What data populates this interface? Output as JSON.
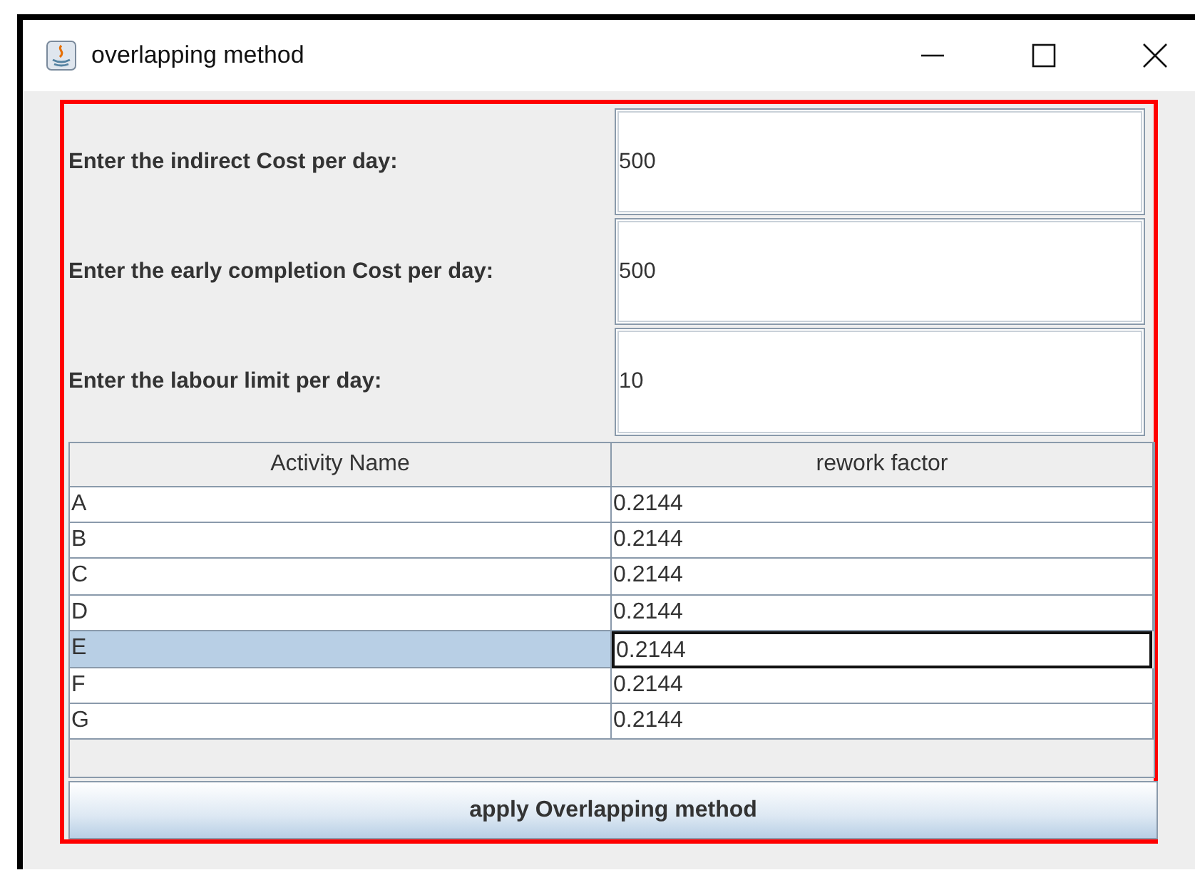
{
  "window": {
    "title": "overlapping method"
  },
  "fields": [
    {
      "label": "Enter the indirect Cost per day:",
      "value": "500"
    },
    {
      "label": "Enter the early completion Cost per day:",
      "value": "500"
    },
    {
      "label": "Enter the labour limit per day:",
      "value": "10"
    }
  ],
  "table": {
    "columns": [
      "Activity Name",
      "rework factor"
    ],
    "rows": [
      {
        "cells": [
          "A",
          "0.2144"
        ],
        "selected": false
      },
      {
        "cells": [
          "B",
          "0.2144"
        ],
        "selected": false
      },
      {
        "cells": [
          "C",
          "0.2144"
        ],
        "selected": false
      },
      {
        "cells": [
          "D",
          "0.2144"
        ],
        "selected": false
      },
      {
        "cells": [
          "E",
          "0.2144"
        ],
        "selected": true
      },
      {
        "cells": [
          "F",
          "0.2144"
        ],
        "selected": false
      },
      {
        "cells": [
          "G",
          "0.2144"
        ],
        "selected": false
      }
    ]
  },
  "button": {
    "label": "apply Overlapping method"
  }
}
